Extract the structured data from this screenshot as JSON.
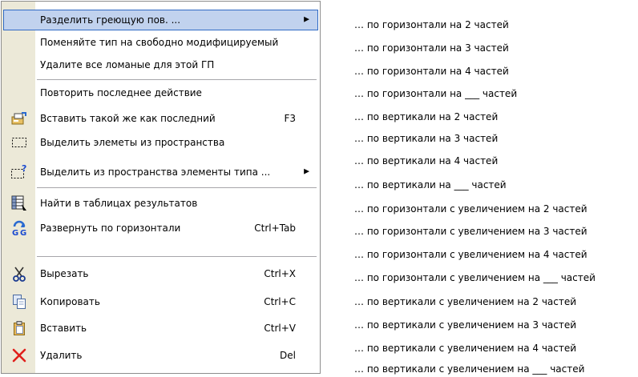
{
  "context_menu": {
    "items": [
      {
        "label": "Разделить греющую пов. ...",
        "shortcut": "",
        "submenu": true,
        "highlighted": true,
        "icon": ""
      },
      {
        "label": "Поменяйте тип на свободно модифицируемый",
        "shortcut": "",
        "submenu": false,
        "icon": ""
      },
      {
        "label": "Удалите все ломаные для этой ГП",
        "shortcut": "",
        "submenu": false,
        "icon": ""
      },
      {
        "label": "Повторить последнее действие",
        "shortcut": "",
        "submenu": false,
        "icon": ""
      },
      {
        "label": "Вставить такой же как последний",
        "shortcut": "F3",
        "submenu": false,
        "icon": "insert-same-icon"
      },
      {
        "label": "Выделить элеметы из пространства",
        "shortcut": "",
        "submenu": false,
        "icon": "select-region-icon"
      },
      {
        "label": "Выделить из пространства элементы типа ...",
        "shortcut": "",
        "submenu": true,
        "icon": "select-region-type-icon"
      },
      {
        "label": "Найти в таблицах результатов",
        "shortcut": "",
        "submenu": false,
        "icon": "results-table-icon"
      },
      {
        "label": "Развернуть по горизонтали",
        "shortcut": "Ctrl+Tab",
        "submenu": false,
        "icon": "flip-horizontal-icon"
      },
      {
        "label": "Вырезать",
        "shortcut": "Ctrl+X",
        "submenu": false,
        "icon": "scissors-icon"
      },
      {
        "label": "Копировать",
        "shortcut": "Ctrl+C",
        "submenu": false,
        "icon": "copy-icon"
      },
      {
        "label": "Вставить",
        "shortcut": "Ctrl+V",
        "submenu": false,
        "icon": "paste-icon"
      },
      {
        "label": "Удалить",
        "shortcut": "Del",
        "submenu": false,
        "icon": "delete-icon"
      }
    ]
  },
  "submenu": {
    "items": [
      "… по горизонтали на 2 частей",
      "… по горизонтали на 3 частей",
      "… по горизонтали на 4 частей",
      "… по горизонтали на ___ частей",
      "… по вертикали на 2 частей",
      "… по вертикали на 3 частей",
      "… по вертикали на 4 частей",
      "… по вертикали на ___ частей",
      "… по горизонтали с увеличением на 2 частей",
      "… по горизонтали с увеличением на 3 частей",
      "… по горизонтали с увеличением на 4 частей",
      "… по горизонтали с увеличением на ___ частей",
      "… по вертикали с увеличением на 2 частей",
      "… по вертикали с увеличением на 3 частей",
      "… по вертикали с увеличением на 4 частей",
      "… по вертикали с увеличением на ___ частей"
    ]
  },
  "colors": {
    "highlight_fill": "#c1d2ee",
    "highlight_border": "#316ac5",
    "gutter": "#ece9d8",
    "separator": "#a7a6aa",
    "delete_icon": "#e0201b"
  }
}
